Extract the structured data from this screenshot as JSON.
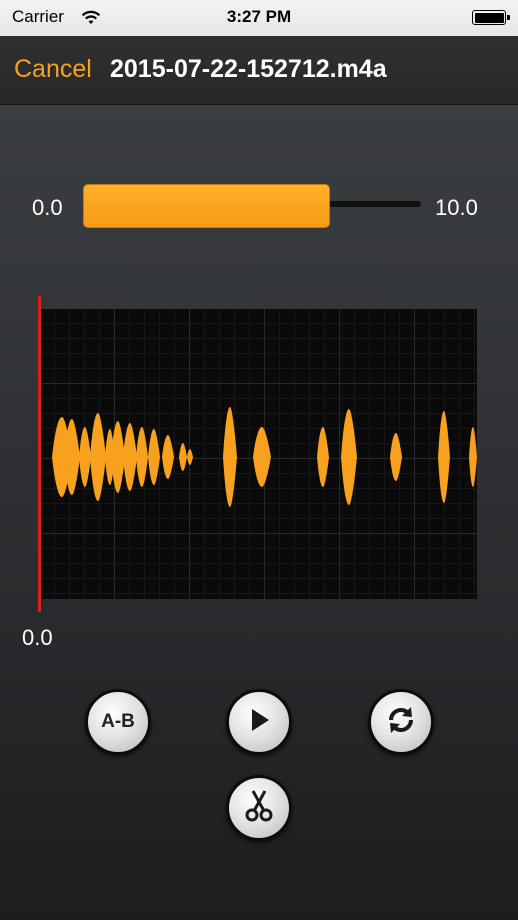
{
  "status_bar": {
    "carrier": "Carrier",
    "time": "3:27 PM",
    "wifi_icon": "wifi-icon",
    "battery_icon": "battery-icon"
  },
  "nav": {
    "cancel_label": "Cancel",
    "title": "2015-07-22-152712.m4a"
  },
  "range_slider": {
    "min_label": "0.0",
    "max_label": "10.0",
    "selected_fraction": 0.73,
    "fill_color": "#f7a11e"
  },
  "waveform": {
    "waveform_color": "#f7a11e",
    "playhead_color": "#d8201c",
    "position_label": "0.0"
  },
  "controls": {
    "ab_label": "A-B",
    "play_icon": "play-icon",
    "loop_icon": "loop-icon",
    "scissors_icon": "scissors-icon"
  }
}
